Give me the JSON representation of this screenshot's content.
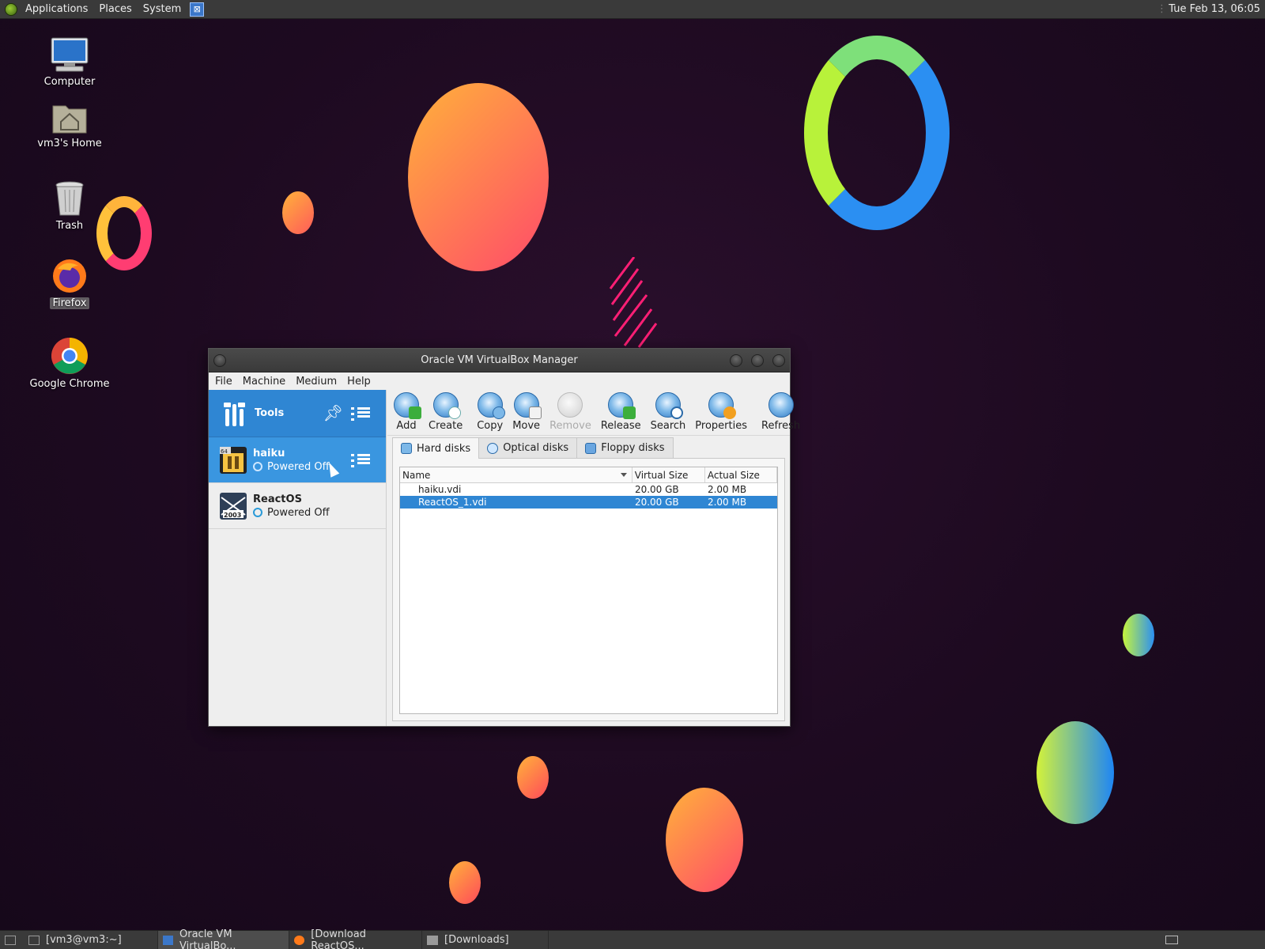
{
  "top_panel": {
    "menus": [
      "Applications",
      "Places",
      "System"
    ],
    "clock": "Tue Feb 13, 06:05"
  },
  "desktop_icons": [
    {
      "label": "Computer",
      "icon": "computer-icon"
    },
    {
      "label": "vm3's Home",
      "icon": "home-folder-icon"
    },
    {
      "label": "Trash",
      "icon": "trash-icon"
    },
    {
      "label": "Firefox",
      "icon": "firefox-icon"
    },
    {
      "label": "Google Chrome",
      "icon": "chrome-icon"
    }
  ],
  "window": {
    "title": "Oracle VM VirtualBox Manager",
    "menu": [
      "File",
      "Machine",
      "Medium",
      "Help"
    ],
    "tools_label": "Tools",
    "vms": [
      {
        "name": "haiku",
        "state": "Powered Off",
        "badge": "64",
        "selected": true
      },
      {
        "name": "ReactOS",
        "state": "Powered Off",
        "badge": "2003",
        "selected": false
      }
    ],
    "toolbar": [
      {
        "label": "Add",
        "enabled": true
      },
      {
        "label": "Create",
        "enabled": true
      },
      {
        "label": "Copy",
        "enabled": true
      },
      {
        "label": "Move",
        "enabled": true
      },
      {
        "label": "Remove",
        "enabled": false
      },
      {
        "label": "Release",
        "enabled": true
      },
      {
        "label": "Search",
        "enabled": true
      },
      {
        "label": "Properties",
        "enabled": true
      },
      {
        "label": "Refresh",
        "enabled": true
      }
    ],
    "tabs": [
      {
        "label": "Hard disks",
        "active": true
      },
      {
        "label": "Optical disks",
        "active": false
      },
      {
        "label": "Floppy disks",
        "active": false
      }
    ],
    "table": {
      "columns": [
        "Name",
        "Virtual Size",
        "Actual Size"
      ],
      "rows": [
        {
          "name": "haiku.vdi",
          "virtual": "20.00 GB",
          "actual": "2.00 MB",
          "selected": false
        },
        {
          "name": "ReactOS_1.vdi",
          "virtual": "20.00 GB",
          "actual": "2.00 MB",
          "selected": true
        }
      ]
    }
  },
  "taskbar": {
    "tasks": [
      {
        "label": "[vm3@vm3:~]",
        "active": false
      },
      {
        "label": "Oracle VM VirtualBo...",
        "active": true
      },
      {
        "label": "[Download ReactOS...",
        "active": false
      },
      {
        "label": "[Downloads]",
        "active": false
      }
    ]
  },
  "colors": {
    "selection": "#2f86d3",
    "panel": "#3a3a3a",
    "desktop_bg": "#1d0a20"
  }
}
